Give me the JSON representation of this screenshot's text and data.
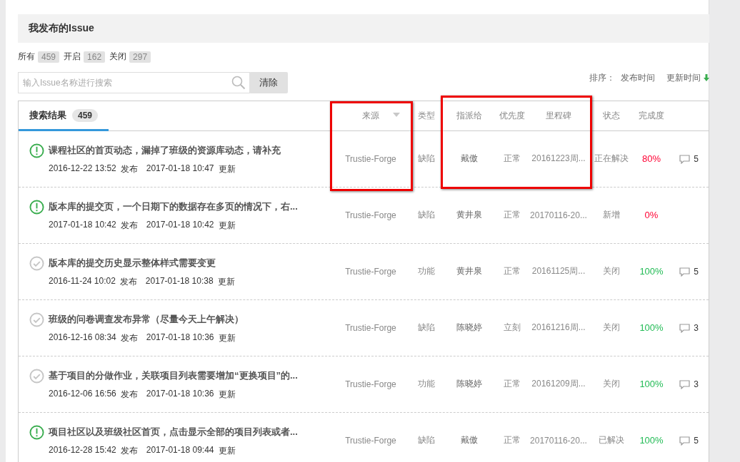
{
  "page_title": "我发布的Issue",
  "counters": [
    {
      "label": "所有",
      "count": "459"
    },
    {
      "label": "开启",
      "count": "162"
    },
    {
      "label": "关闭",
      "count": "297"
    }
  ],
  "search": {
    "placeholder": "输入Issue名称进行搜索"
  },
  "clear_button": "清除",
  "sort": {
    "label": "排序：",
    "options": [
      {
        "label": "发布时间",
        "selected": false
      },
      {
        "label": "更新时间",
        "selected": true
      }
    ]
  },
  "tab": {
    "label": "搜索结果",
    "count": "459",
    "selected": true
  },
  "columns": [
    {
      "label": "来源",
      "dropdown": true,
      "framed": true
    },
    {
      "label": "类型",
      "dropdown": false,
      "framed": false
    },
    {
      "label": "指派给",
      "dropdown": false,
      "framed": true
    },
    {
      "label": "优先度",
      "dropdown": false,
      "framed": true
    },
    {
      "label": "里程碑",
      "dropdown": false,
      "framed": true
    },
    {
      "label": "状态",
      "dropdown": false,
      "framed": false
    },
    {
      "label": "完成度",
      "dropdown": false,
      "framed": false
    }
  ],
  "rows": [
    {
      "kind": "open",
      "title": "课程社区的首页动态，漏掉了班级的资源库动态，请补充",
      "published": "2016-12-22 13:52",
      "published_label": "发布",
      "updated": "2017-01-18 10:47",
      "updated_label": "更新",
      "source": "Trustie-Forge",
      "type": "缺陷",
      "assignee": "戴傲",
      "priority": "正常",
      "milestone": "20161223周...",
      "status": "正在解决",
      "progress": {
        "text": "80%",
        "color": "#ff0033"
      },
      "comments": "5"
    },
    {
      "kind": "open",
      "title": "版本库的提交页，一个日期下的数据存在多页的情况下，右...",
      "published": "2017-01-18 10:42",
      "published_label": "发布",
      "updated": "2017-01-18 10:42",
      "updated_label": "更新",
      "source": "Trustie-Forge",
      "type": "缺陷",
      "assignee": "黄井泉",
      "priority": "正常",
      "milestone": "20170116-20...",
      "status": "新增",
      "progress": {
        "text": "0%",
        "color": "#ff0033"
      }
    },
    {
      "kind": "closed",
      "title": "版本库的提交历史显示整体样式需要变更",
      "published": "2016-11-24 10:02",
      "published_label": "发布",
      "updated": "2017-01-18 10:38",
      "updated_label": "更新",
      "source": "Trustie-Forge",
      "type": "功能",
      "assignee": "黄井泉",
      "priority": "正常",
      "milestone": "20161125周...",
      "status": "关闭",
      "progress": {
        "text": "100%",
        "color": "#22bb55"
      },
      "comments": "5"
    },
    {
      "kind": "closed",
      "title": "班级的问卷调查发布异常（尽量今天上午解决）",
      "published": "2016-12-16 08:34",
      "published_label": "发布",
      "updated": "2017-01-18 10:36",
      "updated_label": "更新",
      "source": "Trustie-Forge",
      "type": "缺陷",
      "assignee": "陈晓婷",
      "priority": "立刻",
      "milestone": "20161216周...",
      "status": "关闭",
      "progress": {
        "text": "100%",
        "color": "#22bb55"
      },
      "comments": "3"
    },
    {
      "kind": "closed",
      "title": "基于项目的分做作业，关联项目列表需要增加“更换项目”的...",
      "published": "2016-12-06 16:56",
      "published_label": "发布",
      "updated": "2017-01-18 10:36",
      "updated_label": "更新",
      "source": "Trustie-Forge",
      "type": "功能",
      "assignee": "陈晓婷",
      "priority": "正常",
      "milestone": "20161209周...",
      "status": "关闭",
      "progress": {
        "text": "100%",
        "color": "#22bb55"
      },
      "comments": "3"
    },
    {
      "kind": "open",
      "title": "项目社区以及班级社区首页，点击显示全部的项目列表或者...",
      "published": "2016-12-28 15:42",
      "published_label": "发布",
      "updated": "2017-01-18 09:44",
      "updated_label": "更新",
      "source": "Trustie-Forge",
      "type": "缺陷",
      "assignee": "戴傲",
      "priority": "正常",
      "milestone": "20170116-20...",
      "status": "已解决",
      "progress": {
        "text": "100%",
        "color": "#22bb55"
      },
      "comments": "5"
    }
  ]
}
